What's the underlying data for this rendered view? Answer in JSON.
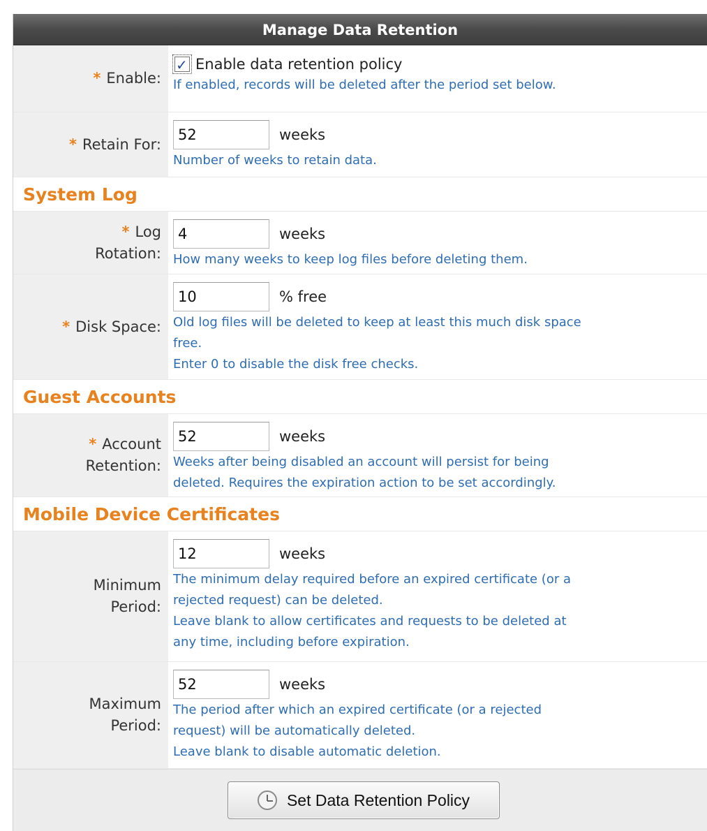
{
  "title": "Manage Data Retention",
  "required_marker": "*",
  "colors": {
    "accent": "#e8821e",
    "help_text": "#2f6db3"
  },
  "enable": {
    "label": "Enable:",
    "checkbox_label": "Enable data retention policy",
    "checked": true,
    "help": "If enabled, records will be deleted after the period set below."
  },
  "retain_for": {
    "label": "Retain For:",
    "value": "52",
    "unit": "weeks",
    "help": "Number of weeks to retain data."
  },
  "system_log": {
    "heading": "System Log",
    "log_rotation": {
      "label_line1": "Log",
      "label_line2": "Rotation:",
      "value": "4",
      "unit": "weeks",
      "help": "How many weeks to keep log files before deleting them."
    },
    "disk_space": {
      "label": "Disk Space:",
      "value": "10",
      "unit": "% free",
      "help1": "Old log files will be deleted to keep at least this much disk space",
      "help2": "free.",
      "help3": "Enter 0 to disable the disk free checks."
    }
  },
  "guest_accounts": {
    "heading": "Guest Accounts",
    "account_retention": {
      "label_line1": "Account",
      "label_line2": "Retention:",
      "value": "52",
      "unit": "weeks",
      "help1": "Weeks after being disabled an account will persist for being",
      "help2": "deleted. Requires the expiration action to be set accordingly."
    }
  },
  "mobile_certs": {
    "heading": "Mobile Device Certificates",
    "minimum_period": {
      "label_line1": "Minimum",
      "label_line2": "Period:",
      "value": "12",
      "unit": "weeks",
      "help1": "The minimum delay required before an expired certificate (or a",
      "help2": "rejected request) can be deleted.",
      "help3": "Leave blank to allow certificates and requests to be deleted at",
      "help4": "any time, including before expiration."
    },
    "maximum_period": {
      "label_line1": "Maximum",
      "label_line2": "Period:",
      "value": "52",
      "unit": "weeks",
      "help1": "The period after which an expired certificate (or a rejected",
      "help2": "request) will be automatically deleted.",
      "help3": "Leave blank to disable automatic deletion."
    }
  },
  "submit_button": {
    "label": "Set Data Retention Policy",
    "icon": "clock-icon"
  }
}
